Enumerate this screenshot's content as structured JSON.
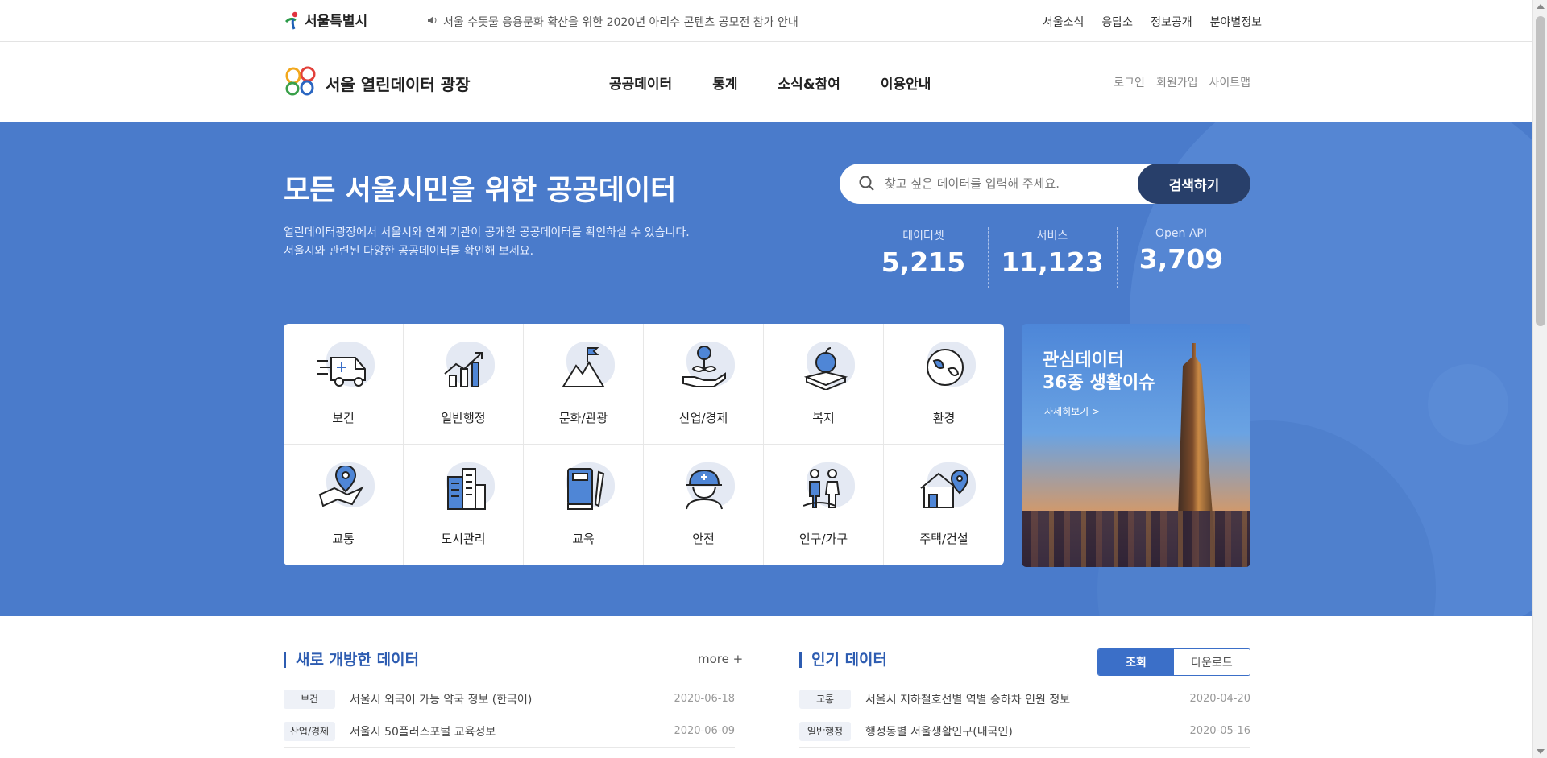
{
  "topbar": {
    "seoul_name": "서울특별시",
    "notice": "서울 수돗물 응용문화 확산을 위한 2020년 아리수 콘텐츠 공모전 참가 안내",
    "links": [
      "서울소식",
      "응답소",
      "정보공개",
      "분야별정보"
    ]
  },
  "header": {
    "site_title": "서울 열린데이터 광장",
    "nav": [
      "공공데이터",
      "통계",
      "소식&참여",
      "이용안내"
    ],
    "member": [
      "로그인",
      "회원가입",
      "사이트맵"
    ]
  },
  "hero": {
    "title": "모든 서울시민을 위한 공공데이터",
    "desc_line1": "열린데이터광장에서 서울시와 연계 기관이 공개한 공공데이터를 확인하실 수 있습니다.",
    "desc_line2": "서울시와 관련된 다양한 공공데이터를 확인해 보세요.",
    "search_placeholder": "찾고 싶은 데이터를 입력해 주세요.",
    "search_button": "검색하기",
    "stats": [
      {
        "label": "데이터셋",
        "value": "5,215"
      },
      {
        "label": "서비스",
        "value": "11,123"
      },
      {
        "label": "Open API",
        "value": "3,709"
      }
    ]
  },
  "categories": [
    "보건",
    "일반행정",
    "문화/관광",
    "산업/경제",
    "복지",
    "환경",
    "교통",
    "도시관리",
    "교육",
    "안전",
    "인구/가구",
    "주택/건설"
  ],
  "category_icons": [
    "ambulance-icon",
    "chart-icon",
    "mountain-flag-icon",
    "money-plant-icon",
    "apple-book-icon",
    "globe-leaf-icon",
    "map-pin-icon",
    "buildings-icon",
    "book-pencil-icon",
    "helmet-worker-icon",
    "family-icon",
    "house-pin-icon"
  ],
  "promo": {
    "title_line1": "관심데이터",
    "title_line2": "36종 생활이슈",
    "more": "자세히보기 >"
  },
  "new_data": {
    "title": "새로 개방한 데이터",
    "more": "more +",
    "rows": [
      {
        "tag": "보건",
        "title": "서울시 외국어 가능 약국 정보 (한국어)",
        "date": "2020-06-18"
      },
      {
        "tag": "산업/경제",
        "title": "서울시 50플러스포털 교육정보",
        "date": "2020-06-09"
      }
    ]
  },
  "popular_data": {
    "title": "인기 데이터",
    "tab_view": "조회",
    "tab_download": "다운로드",
    "rows": [
      {
        "tag": "교통",
        "title": "서울시 지하철호선별 역별 승하차 인원 정보",
        "date": "2020-04-20"
      },
      {
        "tag": "일반행정",
        "title": "행정동별 서울생활인구(내국인)",
        "date": "2020-05-16"
      }
    ]
  },
  "colors": {
    "hero_bg": "#4a7bcb",
    "search_button": "#283f6a",
    "accent": "#2d5cb1"
  }
}
